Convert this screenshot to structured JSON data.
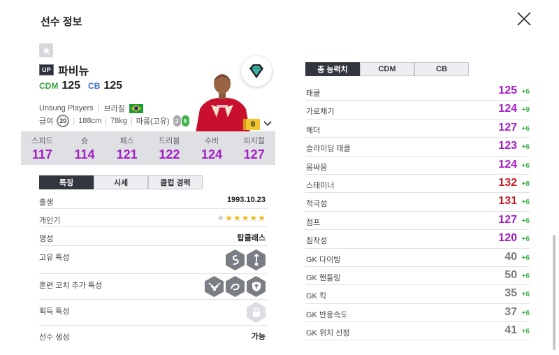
{
  "header": {
    "title": "선수 정보"
  },
  "player": {
    "up_badge": "UP",
    "name": "파비뉴",
    "positions": [
      {
        "pos": "CDM",
        "ovr": "125"
      },
      {
        "pos": "CB",
        "ovr": "125"
      }
    ],
    "team": "Unsung Players",
    "nation": "브라질",
    "salary_label": "급여",
    "salary": "20",
    "height": "188cm",
    "weight": "78kg",
    "body_type": "마름(고유)",
    "weak_foot_left": "2",
    "weak_foot_right": "5",
    "enhance_level": "8"
  },
  "stat_bar": [
    {
      "label": "스피드",
      "value": "117"
    },
    {
      "label": "슛",
      "value": "114"
    },
    {
      "label": "패스",
      "value": "121"
    },
    {
      "label": "드리블",
      "value": "122"
    },
    {
      "label": "수비",
      "value": "124"
    },
    {
      "label": "피지컬",
      "value": "127"
    }
  ],
  "left_tabs": [
    "특징",
    "시세",
    "클럽 경력"
  ],
  "traits": {
    "birth_label": "출생",
    "birth": "1993.10.23",
    "popularity_label": "개인기",
    "popularity_stars": 5,
    "popularity_max": 6,
    "fame_label": "명성",
    "fame": "탑클래스",
    "unique_label": "고유 특성",
    "coach_label": "훈련 코치 추가 특성",
    "acquired_label": "획득 특성",
    "create_label": "선수 생성",
    "create": "가능"
  },
  "right_tabs": [
    "총 능력치",
    "CDM",
    "CB"
  ],
  "attributes": [
    {
      "name": "태클",
      "value": "125",
      "plus": "+6",
      "color": "#a41ec7"
    },
    {
      "name": "가로채기",
      "value": "124",
      "plus": "+9",
      "color": "#a41ec7"
    },
    {
      "name": "헤더",
      "value": "127",
      "plus": "+6",
      "color": "#a41ec7"
    },
    {
      "name": "슬라이딩 태클",
      "value": "123",
      "plus": "+6",
      "color": "#a41ec7"
    },
    {
      "name": "몸싸움",
      "value": "124",
      "plus": "+6",
      "color": "#a41ec7"
    },
    {
      "name": "스태미너",
      "value": "132",
      "plus": "+8",
      "color": "#c41b24"
    },
    {
      "name": "적극성",
      "value": "131",
      "plus": "+6",
      "color": "#c41b24"
    },
    {
      "name": "점프",
      "value": "127",
      "plus": "+6",
      "color": "#a41ec7"
    },
    {
      "name": "침착성",
      "value": "120",
      "plus": "+6",
      "color": "#a41ec7"
    },
    {
      "name": "GK 다이빙",
      "value": "40",
      "plus": "+6",
      "color": "#777a80"
    },
    {
      "name": "GK 핸들링",
      "value": "50",
      "plus": "+6",
      "color": "#777a80"
    },
    {
      "name": "GK 킥",
      "value": "35",
      "plus": "+6",
      "color": "#777a80"
    },
    {
      "name": "GK 반응속도",
      "value": "37",
      "plus": "+6",
      "color": "#777a80"
    },
    {
      "name": "GK 위치 선정",
      "value": "41",
      "plus": "+6",
      "color": "#777a80"
    }
  ]
}
